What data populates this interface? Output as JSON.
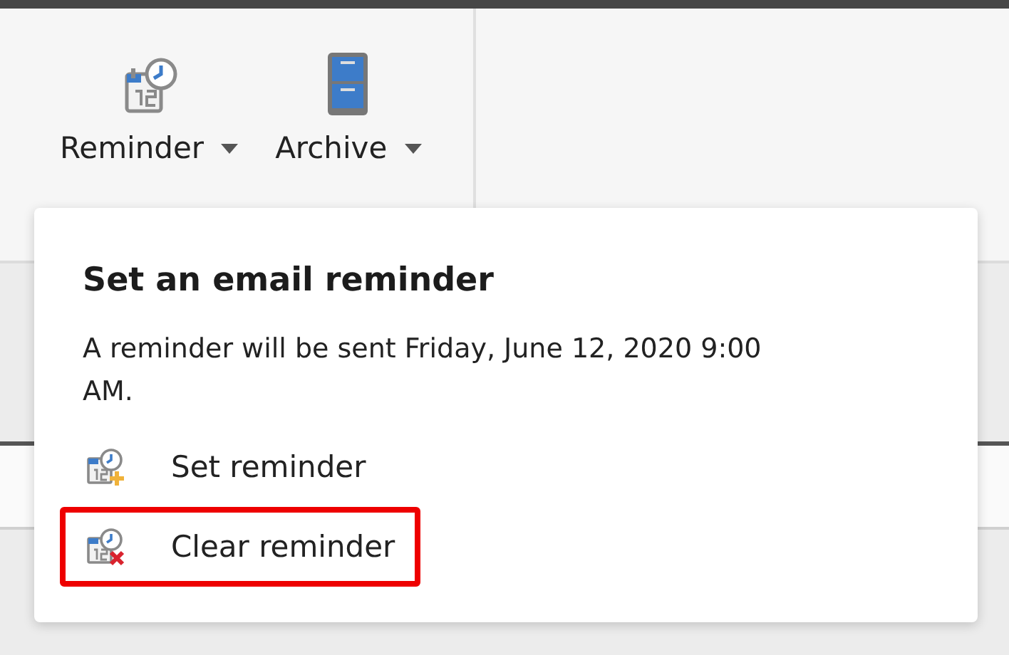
{
  "toolbar": {
    "buttons": [
      {
        "label": "Reminder",
        "kind": "reminder"
      },
      {
        "label": "Archive",
        "kind": "archive"
      }
    ]
  },
  "popup": {
    "title": "Set an email reminder",
    "message": "A reminder will be sent Friday, June 12, 2020 9:00 AM.",
    "items": [
      {
        "label": "Set reminder",
        "kind": "set",
        "highlighted": false
      },
      {
        "label": "Clear reminder",
        "kind": "clear",
        "highlighted": true
      }
    ]
  }
}
